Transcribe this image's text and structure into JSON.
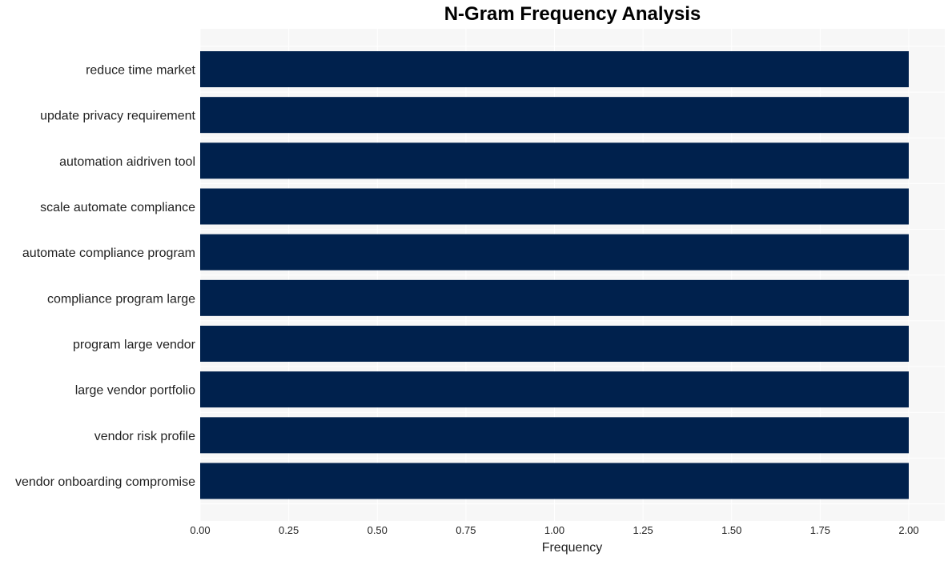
{
  "chart_data": {
    "type": "bar",
    "orientation": "horizontal",
    "title": "N-Gram Frequency Analysis",
    "xlabel": "Frequency",
    "ylabel": "",
    "xlim": [
      0,
      2.1
    ],
    "xticks": [
      "0.00",
      "0.25",
      "0.50",
      "0.75",
      "1.00",
      "1.25",
      "1.50",
      "1.75",
      "2.00"
    ],
    "grid": true,
    "bar_color": "#00214d",
    "background_color": "#f7f7f7",
    "categories": [
      "reduce time market",
      "update privacy requirement",
      "automation aidriven tool",
      "scale automate compliance",
      "automate compliance program",
      "compliance program large",
      "program large vendor",
      "large vendor portfolio",
      "vendor risk profile",
      "vendor onboarding compromise"
    ],
    "values": [
      2,
      2,
      2,
      2,
      2,
      2,
      2,
      2,
      2,
      2
    ]
  }
}
